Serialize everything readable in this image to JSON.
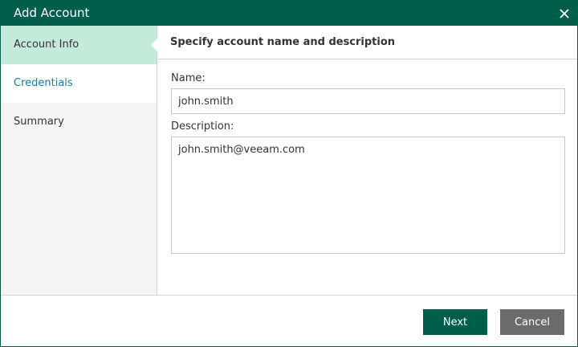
{
  "dialog": {
    "title": "Add Account",
    "close_icon": "close-icon"
  },
  "sidebar": {
    "steps": [
      {
        "label": "Account Info",
        "state": "active"
      },
      {
        "label": "Credentials",
        "state": "link"
      },
      {
        "label": "Summary",
        "state": "inactive"
      }
    ]
  },
  "content": {
    "header": "Specify account name and description",
    "name_label": "Name:",
    "name_value": "john.smith",
    "description_label": "Description:",
    "description_value": "john.smith@veeam.com"
  },
  "footer": {
    "next_label": "Next",
    "cancel_label": "Cancel"
  },
  "colors": {
    "brand": "#005f4b",
    "active_step": "#c4ead9",
    "link": "#1b7ba3",
    "cancel": "#6b6b6b"
  }
}
